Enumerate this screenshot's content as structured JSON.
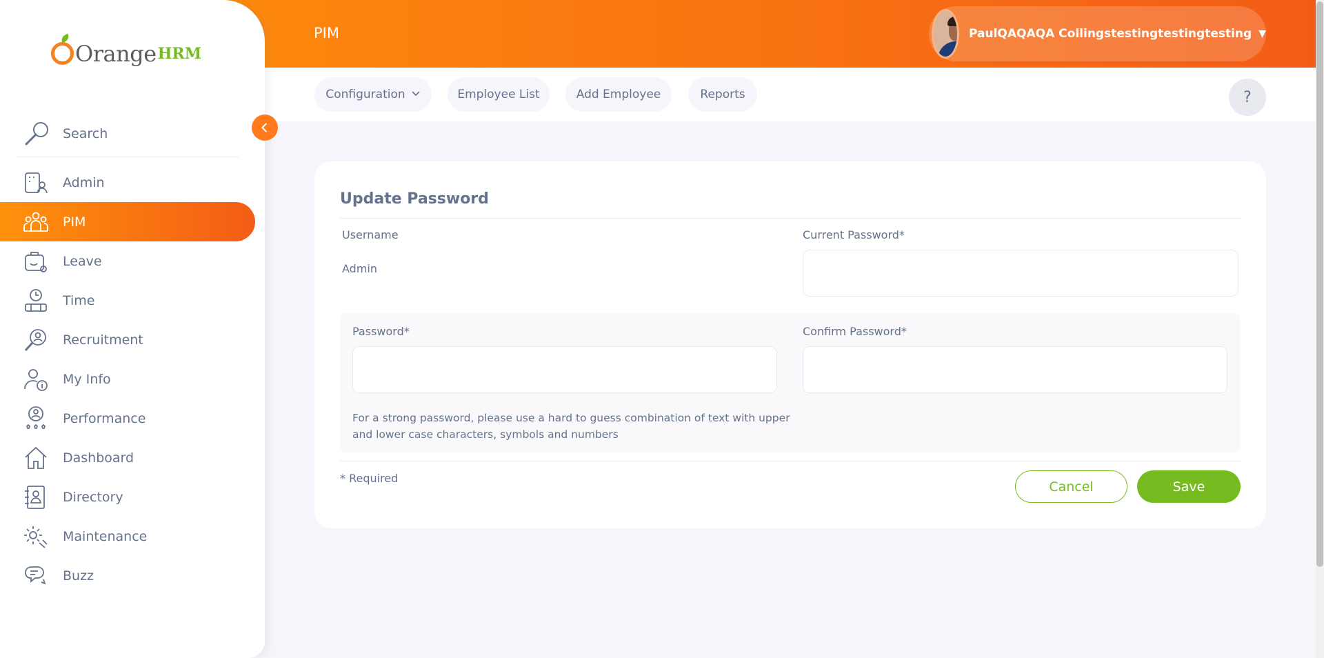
{
  "brand": {
    "logo_text": "Orange",
    "logo_suffix": "HRM"
  },
  "sidebar": {
    "search_placeholder": "Search",
    "items": [
      {
        "label": "Admin",
        "icon": "admin-icon",
        "active": false
      },
      {
        "label": "PIM",
        "icon": "pim-icon",
        "active": true
      },
      {
        "label": "Leave",
        "icon": "leave-icon",
        "active": false
      },
      {
        "label": "Time",
        "icon": "time-icon",
        "active": false
      },
      {
        "label": "Recruitment",
        "icon": "recruitment-icon",
        "active": false
      },
      {
        "label": "My Info",
        "icon": "my-info-icon",
        "active": false
      },
      {
        "label": "Performance",
        "icon": "performance-icon",
        "active": false
      },
      {
        "label": "Dashboard",
        "icon": "dashboard-icon",
        "active": false
      },
      {
        "label": "Directory",
        "icon": "directory-icon",
        "active": false
      },
      {
        "label": "Maintenance",
        "icon": "maintenance-icon",
        "active": false
      },
      {
        "label": "Buzz",
        "icon": "buzz-icon",
        "active": false
      }
    ]
  },
  "header": {
    "module_title": "PIM",
    "user_name": "PaulQAQAQA Collingstestingtestingtesting"
  },
  "subnav": {
    "configuration": "Configuration",
    "employee_list": "Employee List",
    "add_employee": "Add Employee",
    "reports": "Reports",
    "help": "?"
  },
  "form": {
    "title": "Update Password",
    "username_label": "Username",
    "username_value": "Admin",
    "current_password_label": "Current Password*",
    "password_label": "Password*",
    "confirm_password_label": "Confirm Password*",
    "hint": "For a strong password, please use a hard to guess combination of text with upper and lower case characters, symbols and numbers",
    "required_note": "* Required",
    "cancel_label": "Cancel",
    "save_label": "Save"
  },
  "colors": {
    "accent_orange": "#ff7b1d",
    "gradient_start": "#ff920b",
    "gradient_end": "#f35c17",
    "brand_green": "#76bc21",
    "text": "#64728c"
  }
}
